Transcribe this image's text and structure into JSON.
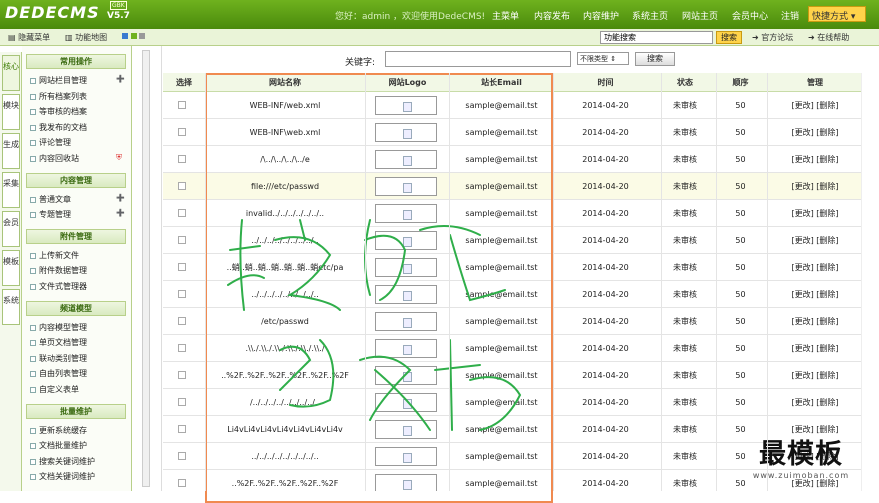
{
  "header": {
    "logo": "DEDECMS",
    "version": "V5.7",
    "badge": "GBK",
    "welcome": "您好：admin ，欢迎使用DedeCMS!",
    "nav": [
      "主菜单",
      "内容发布",
      "内容维护",
      "系统主页",
      "网站主页",
      "会员中心",
      "注销"
    ],
    "quick_menu": "快捷方式"
  },
  "toolbar": {
    "hide_menu": "隐藏菜单",
    "site_map": "功能地图",
    "search_value": "功能搜索",
    "search_btn": "搜索",
    "forum": "官方论坛",
    "help": "在线帮助"
  },
  "vtabs": [
    "核心",
    "模块",
    "生成",
    "采集",
    "会员",
    "模板",
    "系统"
  ],
  "sidebar": {
    "groups": [
      {
        "title": "常用操作",
        "items": [
          "网站栏目管理",
          "所有档案列表",
          "等审核的档案",
          "我发布的文档",
          "评论管理",
          "内容回收站"
        ]
      },
      {
        "title": "内容管理",
        "items": [
          "普通文章",
          "专题管理"
        ]
      },
      {
        "title": "附件管理",
        "items": [
          "上传新文件",
          "附件数据管理",
          "文件式管理器"
        ]
      },
      {
        "title": "频道模型",
        "items": [
          "内容模型管理",
          "单页文档管理",
          "联动类别管理",
          "自由列表管理",
          "自定义表单"
        ]
      },
      {
        "title": "批量维护",
        "items": [
          "更新系统缓存",
          "文档批量维护",
          "搜索关键词维护",
          "文档关键词维护"
        ]
      }
    ]
  },
  "search": {
    "keyword_label": "关键字:",
    "type_select": "不限类型",
    "button": "搜索"
  },
  "table": {
    "headers": [
      "选择",
      "网站名称",
      "网站Logo",
      "站长Email",
      "时间",
      "状态",
      "顺序",
      "管理"
    ],
    "rows": [
      {
        "name": "WEB-INF/web.xml",
        "email": "sample@email.tst",
        "time": "2014-04-20",
        "status": "未审核",
        "order": "50",
        "manage": "[更改] [删除]"
      },
      {
        "name": "WEB-INF\\web.xml",
        "email": "sample@email.tst",
        "time": "2014-04-20",
        "status": "未审核",
        "order": "50",
        "manage": "[更改] [删除]"
      },
      {
        "name": "/\\../\\../\\../\\../e",
        "email": "sample@email.tst",
        "time": "2014-04-20",
        "status": "未审核",
        "order": "50",
        "manage": "[更改] [删除]"
      },
      {
        "name": "file:///etc/passwd",
        "email": "sample@email.tst",
        "time": "2014-04-20",
        "status": "未审核",
        "order": "50",
        "manage": "[更改] [删除]"
      },
      {
        "name": "invalid../../../../../../..",
        "email": "sample@email.tst",
        "time": "2014-04-20",
        "status": "未审核",
        "order": "50",
        "manage": "[更改] [删除]"
      },
      {
        "name": "../../../../../../../../..",
        "email": "sample@email.tst",
        "time": "2014-04-20",
        "status": "未审核",
        "order": "50",
        "manage": "[更改] [删除]"
      },
      {
        "name": "..蛸..蛸..蛸..蛸..蛸..蛸..蛸etc/pa",
        "email": "sample@email.tst",
        "time": "2014-04-20",
        "status": "未审核",
        "order": "50",
        "manage": "[更改] [删除]"
      },
      {
        "name": "../../../../../../../../..",
        "email": "sample@email.tst",
        "time": "2014-04-20",
        "status": "未审核",
        "order": "50",
        "manage": "[更改] [删除]"
      },
      {
        "name": "/etc/passwd",
        "email": "sample@email.tst",
        "time": "2014-04-20",
        "status": "未审核",
        "order": "50",
        "manage": "[更改] [删除]"
      },
      {
        "name": ".\\\\./.\\\\./.\\\\./.\\\\./.\\\\./.\\\\./",
        "email": "sample@email.tst",
        "time": "2014-04-20",
        "status": "未审核",
        "order": "50",
        "manage": "[更改] [删除]"
      },
      {
        "name": "..%2F..%2F..%2F..%2F..%2F..%2F",
        "email": "sample@email.tst",
        "time": "2014-04-20",
        "status": "未审核",
        "order": "50",
        "manage": "[更改] [删除]"
      },
      {
        "name": "/../../../../../../../../..",
        "email": "sample@email.tst",
        "time": "2014-04-20",
        "status": "未审核",
        "order": "50",
        "manage": "[更改] [删除]"
      },
      {
        "name": "Li4vLi4vLi4vLi4vLi4vLi4vLi4v",
        "email": "sample@email.tst",
        "time": "2014-04-20",
        "status": "未审核",
        "order": "50",
        "manage": "[更改] [删除]"
      },
      {
        "name": "../../../../../../../../..",
        "email": "sample@email.tst",
        "time": "2014-04-20",
        "status": "未审核",
        "order": "50",
        "manage": "[更改] [删除]"
      },
      {
        "name": "..%2F..%2F..%2F..%2F..%2F",
        "email": "sample@email.tst",
        "time": "2014-04-20",
        "status": "未审核",
        "order": "50",
        "manage": "[更改] [删除]"
      }
    ]
  },
  "watermark": {
    "title": "最模板",
    "url": "www.zuimoban.com"
  }
}
